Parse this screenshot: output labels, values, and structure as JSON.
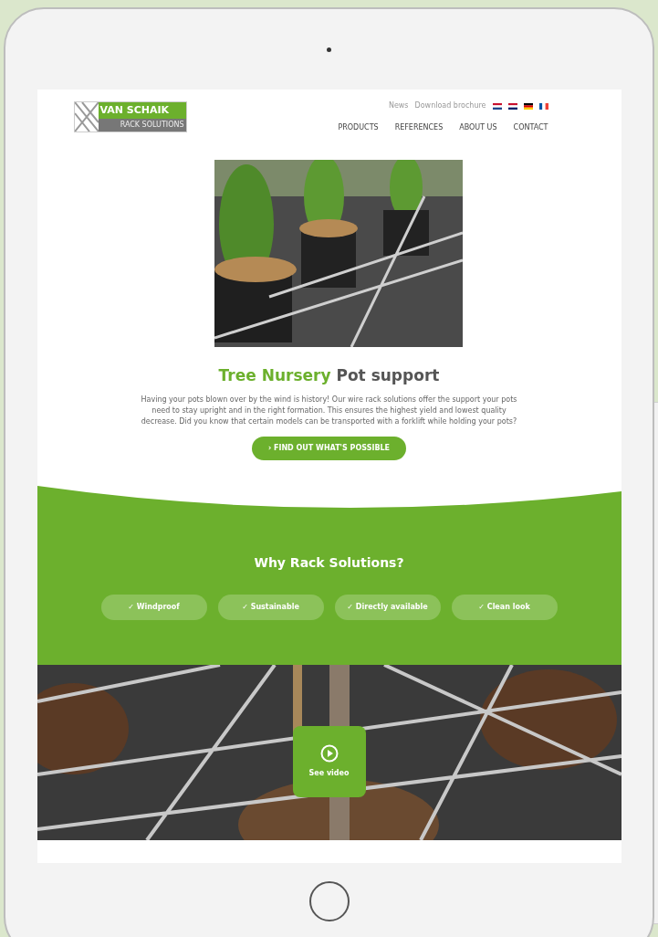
{
  "header": {
    "logo": {
      "name": "VAN SCHAIK",
      "tagline": "RACK SOLUTIONS"
    },
    "top_links": [
      "News",
      "Download brochure"
    ],
    "nav": [
      "PRODUCTS",
      "REFERENCES",
      "ABOUT US",
      "CONTACT"
    ]
  },
  "hero": {
    "title_highlight": "Tree Nursery",
    "title_rest": "Pot support",
    "text": "Having your pots blown over by the wind is history! Our wire rack solutions offer the support your pots need to stay upright and in the right formation. This ensures the highest yield and lowest quality decrease. Did you know that certain models can be transported with a forklift while holding your pots?",
    "button": "› FIND OUT WHAT'S POSSIBLE"
  },
  "why": {
    "title": "Why Rack Solutions?",
    "features": [
      "✓ Windproof",
      "✓ Sustainable",
      "✓ Directly available",
      "✓ Clean look"
    ]
  },
  "video": {
    "button": "See video"
  }
}
